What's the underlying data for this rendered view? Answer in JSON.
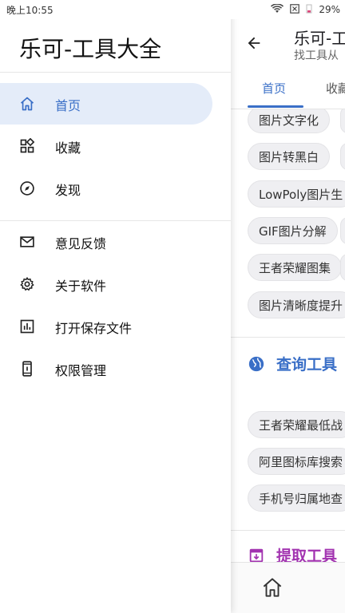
{
  "status_bar": {
    "time": "晚上10:55",
    "battery": "29%"
  },
  "app": {
    "title": "乐可-工",
    "subtitle": "找工具从",
    "tabs": [
      "首页",
      "收藏"
    ],
    "chips_image": [
      "图片文字化",
      "图片转黑白",
      "LowPoly图片生",
      "GIF图片分解",
      "王者荣耀图集",
      "图片清晰度提升"
    ],
    "section_query": {
      "title": "查询工具",
      "color": "#3a6fc7"
    },
    "chips_query": [
      "王者荣耀最低战",
      "阿里图标库搜索",
      "手机号归属地查"
    ],
    "section_extract": {
      "title": "提取工具",
      "color": "#a233b0"
    }
  },
  "drawer": {
    "title": "乐可-工具大全",
    "items": [
      {
        "label": "首页",
        "icon": "home-icon",
        "active": true
      },
      {
        "label": "收藏",
        "icon": "widgets-icon"
      },
      {
        "label": "发现",
        "icon": "compass-icon"
      },
      {
        "label": "意见反馈",
        "icon": "mail-icon"
      },
      {
        "label": "关于软件",
        "icon": "gear-icon"
      },
      {
        "label": "打开保存文件",
        "icon": "chart-box-icon"
      },
      {
        "label": "权限管理",
        "icon": "phone-icon"
      }
    ],
    "accent": "#3a6fc7",
    "active_bg": "#e4ecf9"
  }
}
